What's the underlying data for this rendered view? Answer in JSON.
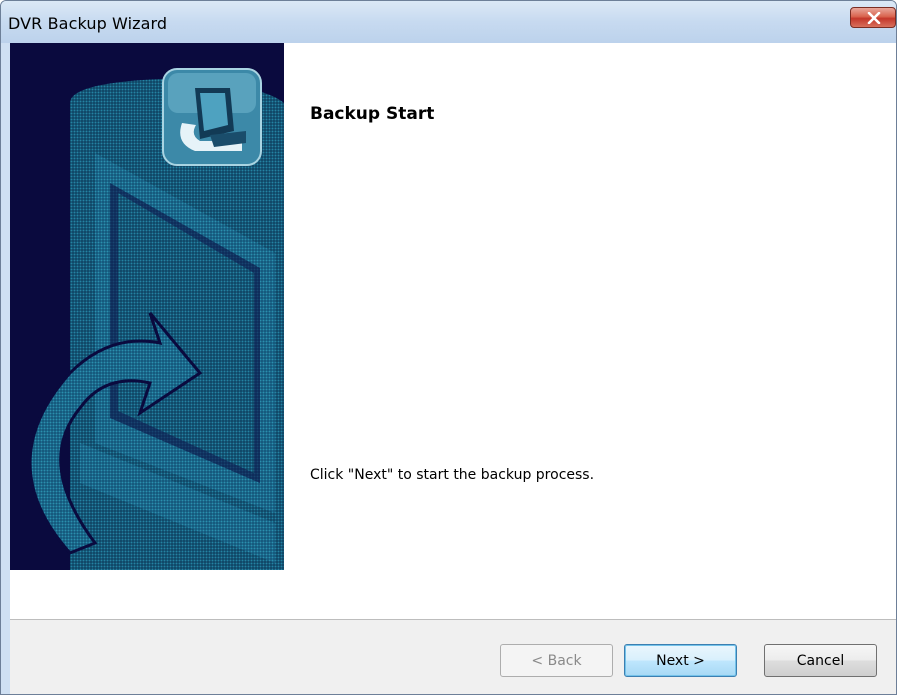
{
  "window": {
    "title": "DVR Backup Wizard",
    "close_icon": "close-icon"
  },
  "page": {
    "heading": "Backup Start",
    "instruction": "Click \"Next\" to start the backup process."
  },
  "buttons": {
    "back_label": "< Back",
    "next_label": "Next >",
    "cancel_label": "Cancel",
    "back_enabled": false
  },
  "colors": {
    "banner_bg": "#0a0a3e",
    "banner_art": "#1f6f8a",
    "close_button": "#c4372a"
  },
  "banner": {
    "icon": "computer-backup-icon"
  }
}
